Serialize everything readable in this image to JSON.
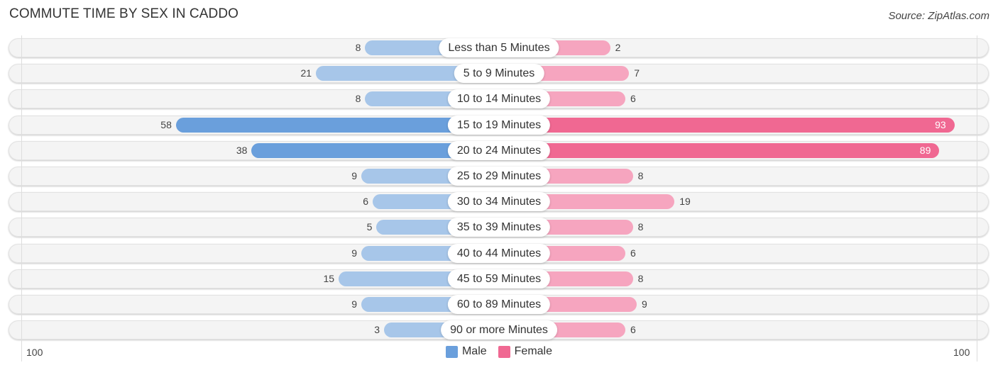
{
  "header": {
    "title": "COMMUTE TIME BY SEX IN CADDO",
    "source": "Source: ZipAtlas.com"
  },
  "colors": {
    "male_strong": "#6a9fdc",
    "male_light": "#a7c6e9",
    "female_strong": "#f06892",
    "female_light": "#f6a5bf"
  },
  "chart_data": {
    "type": "bar",
    "orientation": "horizontal-diverging",
    "title": "COMMUTE TIME BY SEX IN CADDO",
    "categories": [
      "Less than 5 Minutes",
      "5 to 9 Minutes",
      "10 to 14 Minutes",
      "15 to 19 Minutes",
      "20 to 24 Minutes",
      "25 to 29 Minutes",
      "30 to 34 Minutes",
      "35 to 39 Minutes",
      "40 to 44 Minutes",
      "45 to 59 Minutes",
      "60 to 89 Minutes",
      "90 or more Minutes"
    ],
    "series": [
      {
        "name": "Male",
        "values": [
          8,
          21,
          8,
          58,
          38,
          9,
          6,
          5,
          9,
          15,
          9,
          3
        ]
      },
      {
        "name": "Female",
        "values": [
          2,
          7,
          6,
          93,
          89,
          8,
          19,
          8,
          6,
          8,
          9,
          6
        ]
      }
    ],
    "axis": {
      "left_tick": "100",
      "right_tick": "100",
      "range": [
        100,
        100
      ]
    },
    "legend": {
      "placement": "bottom-center",
      "entries": [
        "Male",
        "Female"
      ]
    },
    "grid": false
  }
}
